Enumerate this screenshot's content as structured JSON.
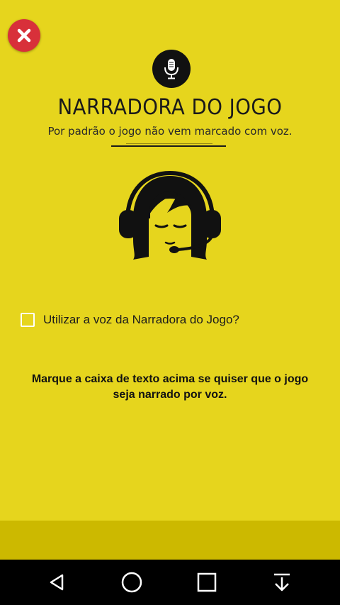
{
  "colors": {
    "background": "#e6d51d",
    "bottom_strip": "#ccb900",
    "close_button": "#d8303a",
    "navbar": "#000000"
  },
  "header": {
    "close_icon": "close-x-icon",
    "mic_icon": "microphone-icon",
    "title": "NARRADORA DO JOGO",
    "subtitle": "Por padrão o jogo não vem marcado com voz."
  },
  "illustration": {
    "icon": "narrator-headset-icon"
  },
  "option": {
    "checkbox_checked": false,
    "label": "Utilizar a voz da Narradora do Jogo?"
  },
  "instruction": {
    "line1": "Marque a caixa de texto acima se quiser que o jogo",
    "line2": "seja narrado por voz."
  },
  "navbar": {
    "back_icon": "back-triangle-icon",
    "home_icon": "home-circle-icon",
    "recents_icon": "recents-square-icon",
    "download_icon": "arrow-down-icon"
  }
}
